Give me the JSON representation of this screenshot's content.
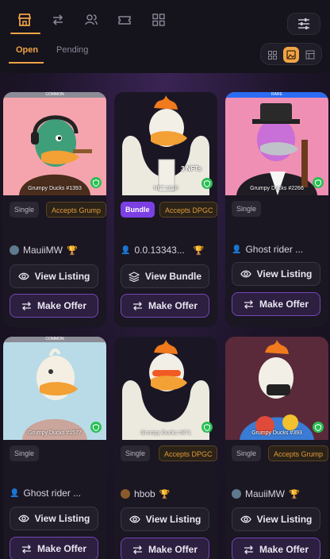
{
  "nav": {
    "icons": [
      "store-icon",
      "swap-icon",
      "users-icon",
      "ticket-icon",
      "grid-icon"
    ],
    "active": "store-icon"
  },
  "tabs": [
    {
      "label": "Open",
      "active": true
    },
    {
      "label": "Pending",
      "active": false
    }
  ],
  "view_toggle": [
    "grid-small-icon",
    "image-icon",
    "table-icon"
  ],
  "buttons": {
    "view_listing": "View Listing",
    "view_bundle": "View Bundle",
    "make_offer": "Make Offer"
  },
  "cards": [
    {
      "rarity": "COMMON",
      "caption": "Grumpy Ducks #1393",
      "type": "Single",
      "accepts": "Accepts Grump",
      "owner": "MauiiMW",
      "action": "View Listing"
    },
    {
      "rarity": "",
      "caption": "NFT #610",
      "extra_tag": "3 NFTs",
      "type": "Bundle",
      "accepts": "Accepts DPGC",
      "owner": "0.0.13343...",
      "action": "View Bundle"
    },
    {
      "rarity": "RARE",
      "caption": "Grumpy Ducks #2266",
      "type": "Single",
      "accepts": "",
      "owner": "Ghost rider ...",
      "action": "View Listing"
    },
    {
      "rarity": "COMMON",
      "caption": "Grumpy Ducks #1577",
      "type": "Single",
      "accepts": "",
      "owner": "Ghost rider ...",
      "action": "View Listing"
    },
    {
      "rarity": "",
      "caption": "Grumpy Ducks #871",
      "type": "Single",
      "accepts": "Accepts DPGC",
      "owner": "hbob",
      "action": "View Listing"
    },
    {
      "rarity": "",
      "caption": "Grumpy Ducks #393",
      "type": "Single",
      "accepts": "Accepts Grump",
      "owner": "MauiiMW",
      "action": "View Listing"
    }
  ],
  "colors": {
    "accent": "#f0a445",
    "bundle": "#7b3fe4",
    "verified": "#2bbf55"
  }
}
